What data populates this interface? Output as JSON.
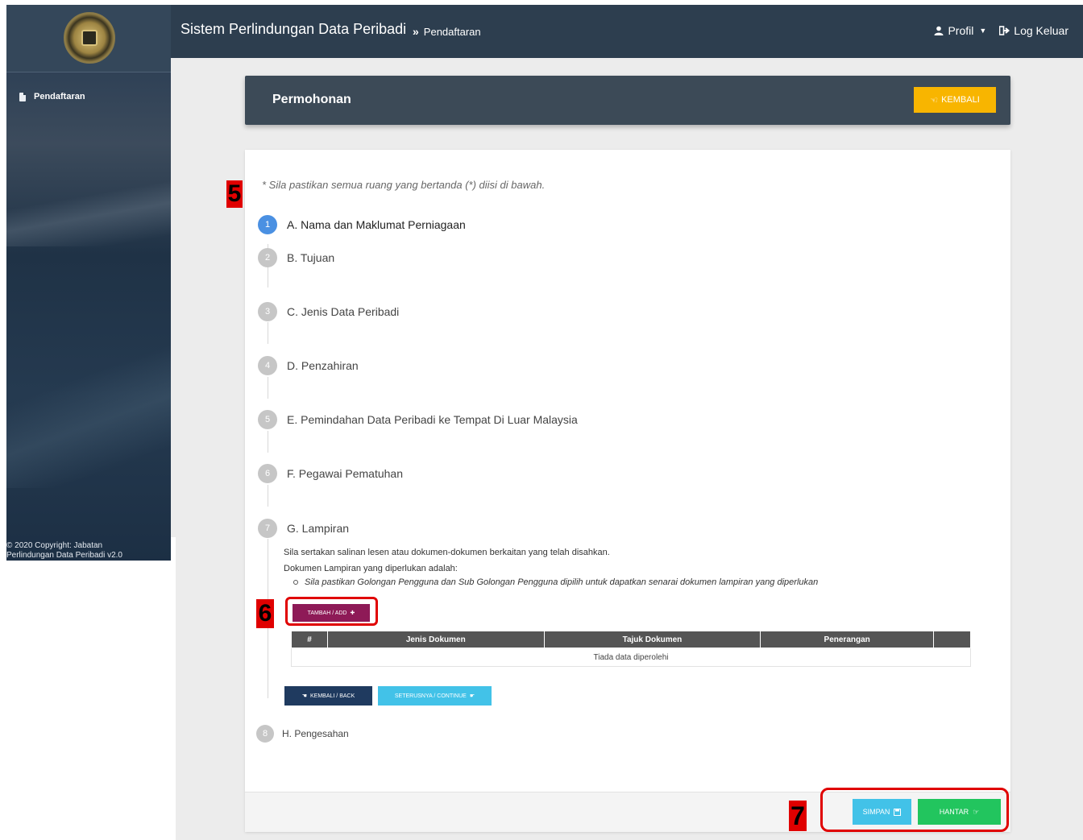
{
  "header": {
    "app_title": "Sistem Perlindungan Data Peribadi",
    "breadcrumb": "Pendaftaran",
    "profile_label": "Profil",
    "logout_label": "Log Keluar"
  },
  "sidebar": {
    "items": [
      {
        "label": "Pendaftaran",
        "icon": "document-icon"
      }
    ],
    "copyright_line1": "© 2020 Copyright: Jabatan",
    "copyright_line2": "Perlindungan Data Peribadi v2.0"
  },
  "page": {
    "title": "Permohonan",
    "back_button": "KEMBALI",
    "note": "* Sila pastikan semua ruang yang bertanda (*) diisi di bawah."
  },
  "steps": [
    {
      "num": "1",
      "label": "A. Nama dan Maklumat Perniagaan",
      "active": true
    },
    {
      "num": "2",
      "label": "B. Tujuan"
    },
    {
      "num": "3",
      "label": "C. Jenis Data Peribadi"
    },
    {
      "num": "4",
      "label": "D. Penzahiran"
    },
    {
      "num": "5",
      "label": "E. Pemindahan Data Peribadi ke Tempat Di Luar Malaysia"
    },
    {
      "num": "6",
      "label": "F. Pegawai Pematuhan"
    },
    {
      "num": "7",
      "label": "G. Lampiran"
    },
    {
      "num": "8",
      "label": "H. Pengesahan"
    }
  ],
  "lampiran": {
    "line1": "Sila sertakan salinan lesen atau dokumen-dokumen berkaitan yang telah disahkan.",
    "line2": "Dokumen Lampiran yang diperlukan adalah:",
    "bullet": "Sila pastikan Golongan Pengguna dan Sub Golongan Pengguna dipilih untuk dapatkan senarai dokumen lampiran yang diperlukan",
    "add_button": "TAMBAH / ADD",
    "table_headers": [
      "#",
      "Jenis Dokumen",
      "Tajuk Dokumen",
      "Penerangan",
      ""
    ],
    "empty_text": "Tiada data diperolehi",
    "back_button": "KEMBALI / BACK",
    "continue_button": "SETERUSNYA / CONTINUE"
  },
  "footer": {
    "save_button": "SIMPAN",
    "submit_button": "HANTAR"
  },
  "annotations": [
    "5",
    "6",
    "7"
  ],
  "colors": {
    "header_bg": "#2d3e4f",
    "active_step": "#4a90e2",
    "back_top": "#f8b500",
    "add_button": "#8e1a57",
    "save": "#42c2e8",
    "submit": "#22c55e",
    "annotation": "#e00000"
  }
}
